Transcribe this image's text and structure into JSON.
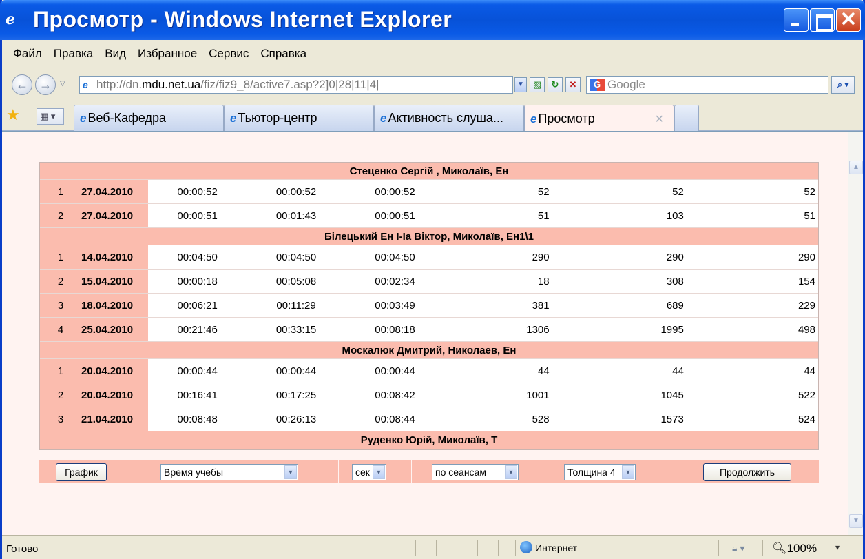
{
  "window": {
    "title": "Просмотр - Windows Internet Explorer"
  },
  "menu": [
    "Файл",
    "Правка",
    "Вид",
    "Избранное",
    "Сервис",
    "Справка"
  ],
  "address": {
    "url_prefix": "http://dn.",
    "url_domain": "mdu.net.ua",
    "url_path": "/fiz/fiz9_8/active7.asp?2]0|28|11|4|"
  },
  "search": {
    "placeholder": "Google"
  },
  "tabs": [
    {
      "label": "Веб-Кафедра"
    },
    {
      "label": "Тьютор-центр"
    },
    {
      "label": "Активность слуша..."
    },
    {
      "label": "Просмотр"
    }
  ],
  "table": {
    "groups": [
      {
        "title": "Стеценко Сергій , Миколаїв, Ен",
        "rows": [
          {
            "n": "1",
            "date": "27.04.2010",
            "t1": "00:00:52",
            "t2": "00:00:52",
            "t3": "00:00:52",
            "v1": "52",
            "v2": "52",
            "v3": "52"
          },
          {
            "n": "2",
            "date": "27.04.2010",
            "t1": "00:00:51",
            "t2": "00:01:43",
            "t3": "00:00:51",
            "v1": "51",
            "v2": "103",
            "v3": "51"
          }
        ]
      },
      {
        "title": "Білецький Ен І-Іа Віктор, Миколаїв, Ен1\\1",
        "rows": [
          {
            "n": "1",
            "date": "14.04.2010",
            "t1": "00:04:50",
            "t2": "00:04:50",
            "t3": "00:04:50",
            "v1": "290",
            "v2": "290",
            "v3": "290"
          },
          {
            "n": "2",
            "date": "15.04.2010",
            "t1": "00:00:18",
            "t2": "00:05:08",
            "t3": "00:02:34",
            "v1": "18",
            "v2": "308",
            "v3": "154"
          },
          {
            "n": "3",
            "date": "18.04.2010",
            "t1": "00:06:21",
            "t2": "00:11:29",
            "t3": "00:03:49",
            "v1": "381",
            "v2": "689",
            "v3": "229"
          },
          {
            "n": "4",
            "date": "25.04.2010",
            "t1": "00:21:46",
            "t2": "00:33:15",
            "t3": "00:08:18",
            "v1": "1306",
            "v2": "1995",
            "v3": "498"
          }
        ]
      },
      {
        "title": "Москалюк  Дмитрий, Николаев, Ен",
        "rows": [
          {
            "n": "1",
            "date": "20.04.2010",
            "t1": "00:00:44",
            "t2": "00:00:44",
            "t3": "00:00:44",
            "v1": "44",
            "v2": "44",
            "v3": "44"
          },
          {
            "n": "2",
            "date": "20.04.2010",
            "t1": "00:16:41",
            "t2": "00:17:25",
            "t3": "00:08:42",
            "v1": "1001",
            "v2": "1045",
            "v3": "522"
          },
          {
            "n": "3",
            "date": "21.04.2010",
            "t1": "00:08:48",
            "t2": "00:26:13",
            "t3": "00:08:44",
            "v1": "528",
            "v2": "1573",
            "v3": "524"
          }
        ]
      },
      {
        "title": "Руденко Юрій, Миколаїв, Т",
        "rows": []
      }
    ]
  },
  "controls": {
    "graph_label": "График",
    "time_select": "Время учебы",
    "unit_select": "сек",
    "mode_select": "по сеансам",
    "thickness_select": "Толщина 4",
    "continue_label": "Продолжить"
  },
  "status": {
    "text": "Готово",
    "zone": "Интернет",
    "zoom": "100%"
  }
}
